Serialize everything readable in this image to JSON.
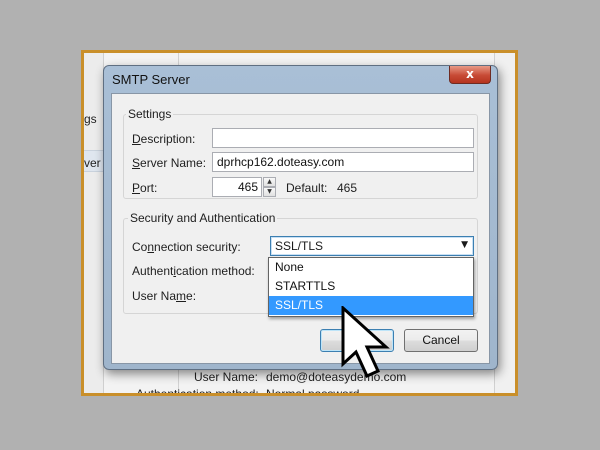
{
  "background": {
    "left_fragments": [
      "gs",
      "ver"
    ],
    "right_rows": [
      {
        "label": "User Name:",
        "value": "demo@doteasydemo.com"
      },
      {
        "label": "Authentication method:",
        "value": "Normal password"
      }
    ]
  },
  "dialog": {
    "title": "SMTP Server",
    "close_glyph": "x",
    "settings": {
      "legend": "Settings",
      "description": {
        "label": "Description:",
        "underline": "D",
        "rest": "escription:",
        "value": ""
      },
      "server_name": {
        "label": "Server Name:",
        "underline": "S",
        "rest": "erver Name:",
        "value": "dprhcp162.doteasy.com"
      },
      "port": {
        "label": "Port:",
        "underline": "P",
        "rest": "ort:",
        "value": "465",
        "default_label": "Default:",
        "default_value": "465"
      }
    },
    "security": {
      "legend": "Security and Authentication",
      "connection_security": {
        "label_pre": "Co",
        "underline": "n",
        "label_post": "nection security:",
        "selected": "SSL/TLS",
        "options": [
          "None",
          "STARTTLS",
          "SSL/TLS"
        ]
      },
      "auth_method": {
        "label_pre": "Authent",
        "underline": "i",
        "label_post": "cation method:"
      },
      "user_name": {
        "label_pre": "User Na",
        "underline": "m",
        "label_post": "e:"
      }
    },
    "buttons": {
      "ok": "",
      "cancel": "Cancel"
    }
  },
  "icons": {
    "spin_up": "up-arrow",
    "spin_down": "down-arrow",
    "dropdown": "chevron-down",
    "cursor": "pointer-arrow"
  },
  "colors": {
    "frame": "#c98f2a",
    "selection": "#3399ff",
    "close": "#c74a35"
  }
}
